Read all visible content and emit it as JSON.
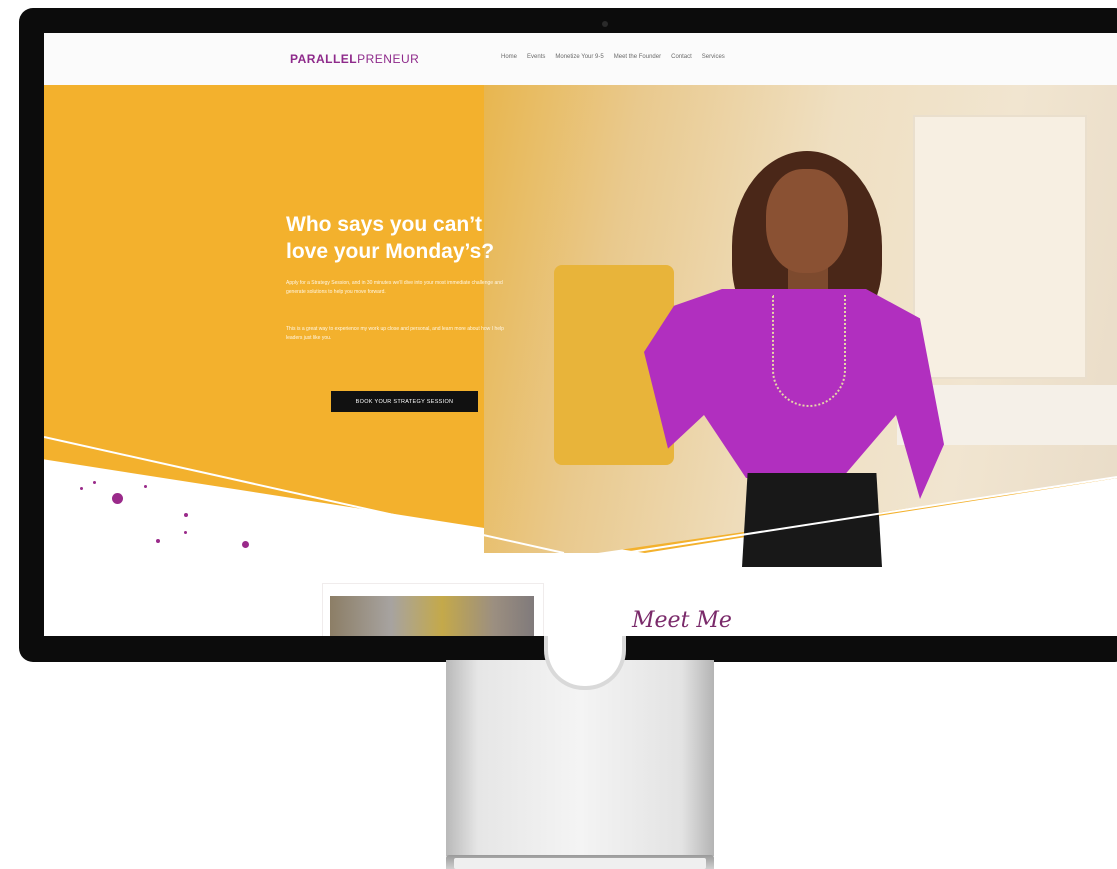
{
  "website": {
    "logo_bold": "PARALLEL",
    "logo_light": "PRENEUR",
    "nav": [
      "Home",
      "Events",
      "Monetize Your 9-5",
      "Meet the Founder",
      "Contact",
      "Services"
    ],
    "hero": {
      "headline": "Who says you can’t love your Monday’s?",
      "paragraph1": "Apply for a Strategy Session, and in 30 minutes we’ll dive into your most immediate challenge and generate solutions to help you move forward.",
      "paragraph2": "This is a great way to experience my work up close and personal, and learn more about how I help leaders just like you.",
      "cta_label": "BOOK YOUR STRATEGY SESSION"
    },
    "signature_text": "Meet Me"
  },
  "colors": {
    "hero_yellow": "#f3b12d",
    "brand_purple": "#8e2a8b",
    "cta_black": "#111111"
  }
}
